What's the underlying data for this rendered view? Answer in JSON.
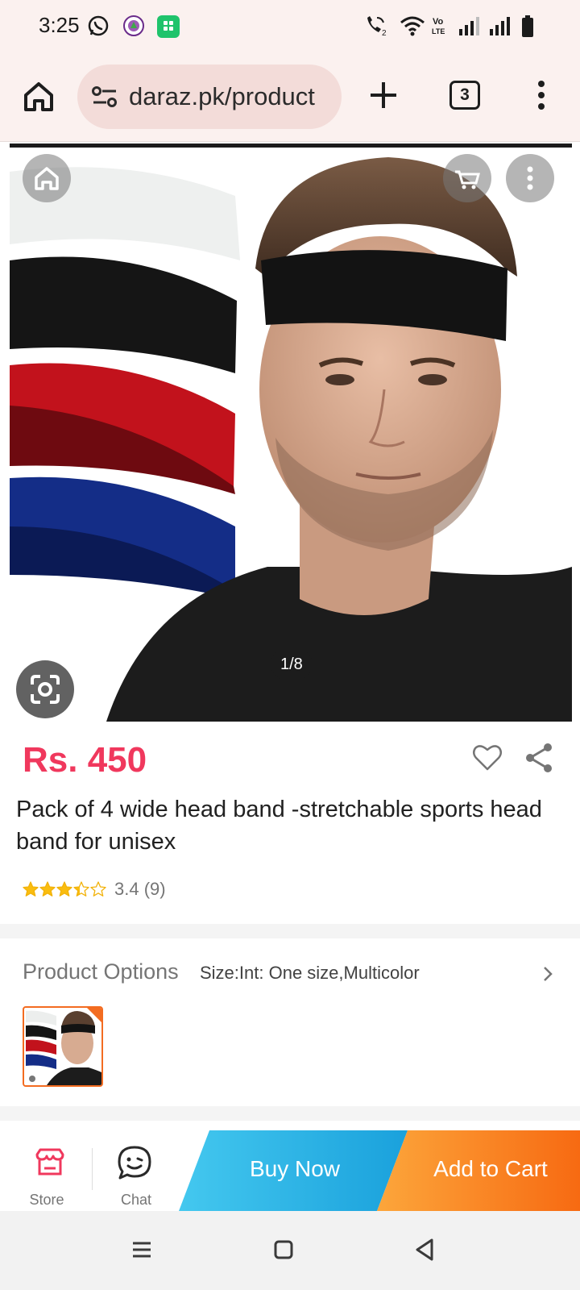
{
  "status_bar": {
    "time": "3:25",
    "icons": [
      "whatsapp-icon",
      "app-notification-icon",
      "green-app-icon",
      "wifi-call-icon",
      "wifi-icon",
      "volte-icon",
      "signal-icon",
      "signal-icon",
      "battery-icon"
    ]
  },
  "browser": {
    "url": "daraz.pk/product",
    "tab_count": "3"
  },
  "gallery": {
    "counter": "1/8",
    "current": 1,
    "total": 8
  },
  "product": {
    "price": "Rs. 450",
    "title": "Pack of 4 wide head band -stretchable sports head band for unisex",
    "rating_value": 3.4,
    "rating_text": "3.4 (9)"
  },
  "options": {
    "label": "Product Options",
    "value": "Size:Int: One size,Multicolor"
  },
  "actions": {
    "store_label": "Store",
    "chat_label": "Chat",
    "buy_now_label": "Buy Now",
    "add_to_cart_label": "Add to Cart"
  },
  "colors": {
    "price": "#f0385d",
    "buy_now": "#1aa1dc",
    "add_to_cart": "#f76a12",
    "accent_border": "#f36c21",
    "toolbar_bg": "#fbf1ef"
  }
}
